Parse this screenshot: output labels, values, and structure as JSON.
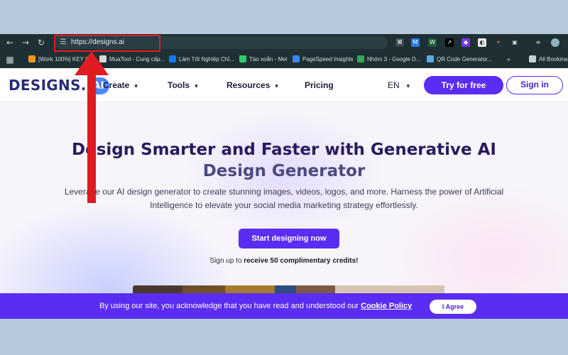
{
  "browser": {
    "url": "https://designs.ai",
    "more_label": "»",
    "bookmarks": [
      {
        "label": "[Work 100%] KEY O...",
        "color": "#f29b1b"
      },
      {
        "label": "MuaTool - Cung cấp...",
        "color": "#d9d9d9"
      },
      {
        "label": "Làm Tốt Nghiệp Chỉ...",
        "color": "#1877f2"
      },
      {
        "label": "Tảo xoắn - Mei",
        "color": "#2ecc71"
      },
      {
        "label": "PageSpeed Insights",
        "color": "#4285f4"
      },
      {
        "label": "Nhóm 3 - Google D...",
        "color": "#34a853"
      },
      {
        "label": "QR Code Generator...",
        "color": "#5aa9e6"
      },
      {
        "label": "All Bookma",
        "color": "#c7d3d6"
      }
    ]
  },
  "site": {
    "logo_text": "DESIGNS.",
    "logo_badge": "AI",
    "nav": {
      "create": "Create",
      "tools": "Tools",
      "resources": "Resources",
      "pricing": "Pricing",
      "language": "EN",
      "try_free": "Try for free",
      "sign_in": "Sign in"
    },
    "hero": {
      "title_line1": "Design Smarter and Faster with Generative AI",
      "title_line2": "Design Generator",
      "subtitle": "Leverage our AI design generator to create stunning images, videos, logos, and more. Harness the power of Artificial Intelligence to elevate your social media marketing strategy effortlessly.",
      "cta": "Start designing now",
      "credits_prefix": "Sign up to ",
      "credits_bold": "receive 50 complimentary credits!"
    },
    "cookie": {
      "text": "By using our site, you acknowledge that you have read and understood our ",
      "link": "Cookie Policy",
      "agree": "I Agree"
    }
  }
}
